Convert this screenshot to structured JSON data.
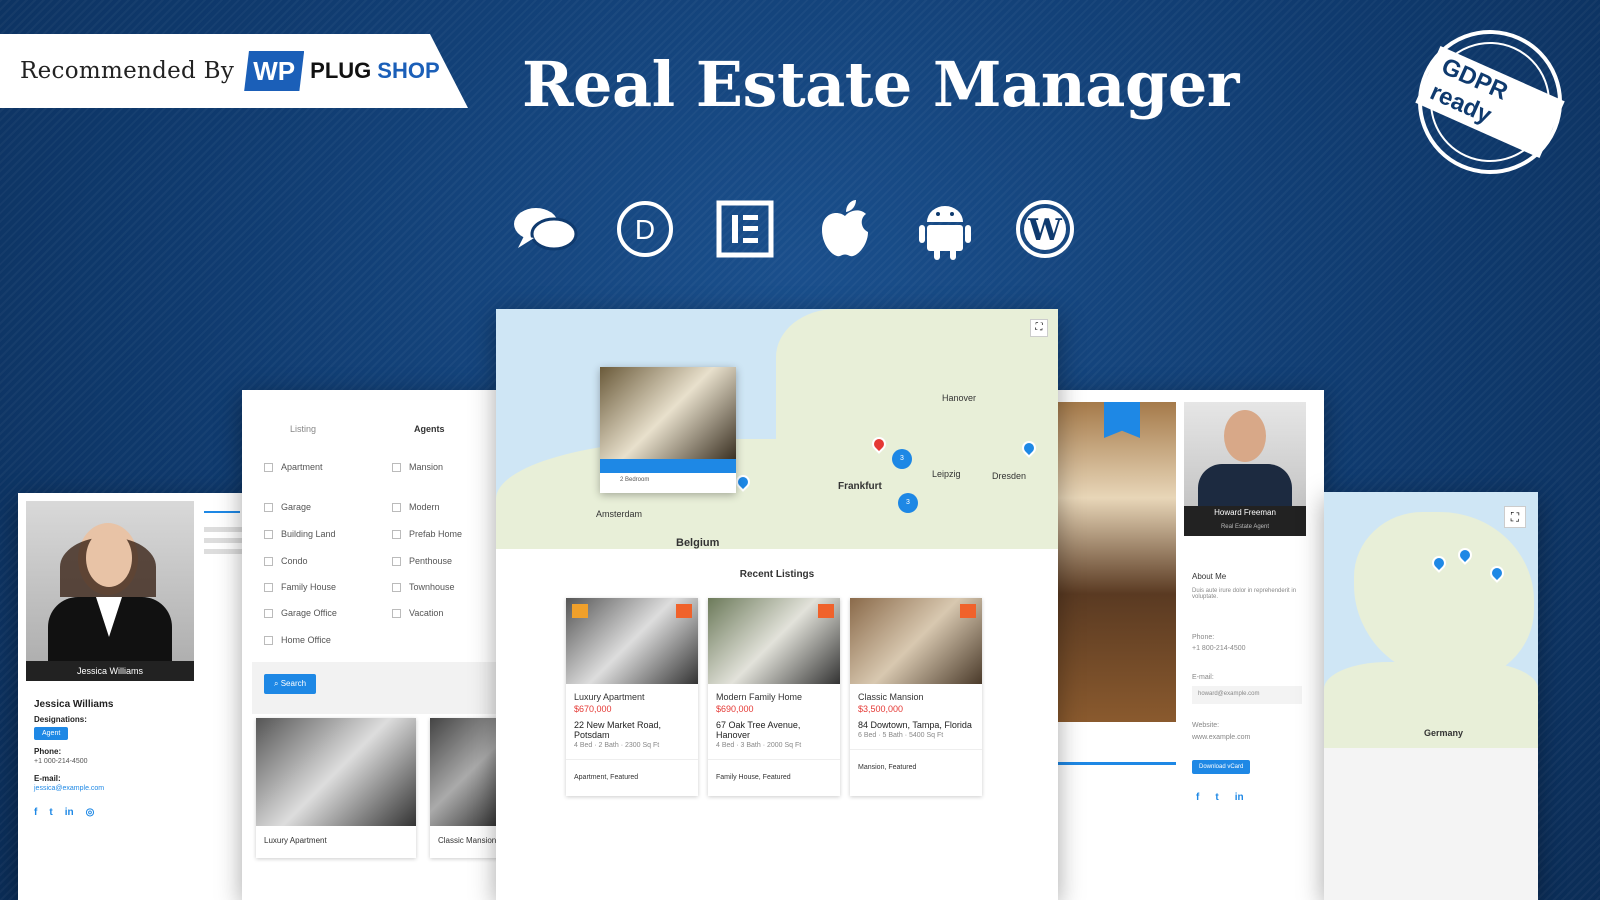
{
  "badge": {
    "recommended": "Recommended By",
    "wp": "WP",
    "plug": "PLUG",
    "shop": "SHOP"
  },
  "title": "Real Estate Manager",
  "stamp": "GDPR ready",
  "icons": [
    "chat-icon",
    "divi-icon",
    "elementor-icon",
    "apple-icon",
    "android-icon",
    "wordpress-icon"
  ],
  "colors": {
    "background": "#0f3a6e",
    "accent": "#1e88e5",
    "price": "#e53935",
    "tag": "#f0622b"
  },
  "agent_left": {
    "name": "Jessica Williams",
    "caption": "Jessica Williams",
    "designations_label": "Designations:",
    "designation": "Agent",
    "phone_label": "Phone:",
    "phone": "+1 000-214-4500",
    "email_label": "E-mail:",
    "email": "jessica@example.com"
  },
  "search": {
    "tab_listing": "Listing",
    "tab_agents": "Agents",
    "col1": [
      "Apartment",
      "Garage",
      "Building Land",
      "Condo",
      "Family House",
      "Garage Office",
      "Home Office"
    ],
    "col2": [
      "Mansion",
      "Modern",
      "Prefab Home",
      "Penthouse",
      "Townhouse",
      "Vacation"
    ],
    "button": "Search"
  },
  "search_results": {
    "r1_title": "Luxury Apartment",
    "r2_title": "Classic Mansion"
  },
  "map_main": {
    "cities": [
      "Hanover",
      "Frankfurt",
      "Belgium",
      "Leipzig",
      "Dresden",
      "Amsterdam"
    ],
    "popup_line": "2 Bedroom"
  },
  "recent": {
    "heading": "Recent Listings",
    "cards": [
      {
        "title": "Luxury Apartment",
        "price": "$670,000",
        "address": "22 New Market Road, Potsdam",
        "meta": "4 Bed · 2 Bath · 2300 Sq Ft",
        "footer": "Apartment, Featured"
      },
      {
        "title": "Modern Family Home",
        "price": "$690,000",
        "address": "67 Oak Tree Avenue, Hanover",
        "meta": "4 Bed · 3 Bath · 2000 Sq Ft",
        "footer": "Family House, Featured"
      },
      {
        "title": "Classic Mansion",
        "price": "$3,500,000",
        "address": "84 Dowtown, Tampa, Florida",
        "meta": "6 Bed · 5 Bath · 5400 Sq Ft",
        "footer": "Mansion, Featured"
      }
    ]
  },
  "agent_right": {
    "name": "Howard Freeman",
    "role": "Real Estate Agent",
    "about_label": "About Me",
    "about": "Duis aute irure dolor in reprehenderit in voluptate.",
    "phone_label": "Phone:",
    "phone": "+1 800-214-4500",
    "email_label": "E-mail:",
    "email": "howard@example.com",
    "website_label": "Website:",
    "website": "www.example.com",
    "vcard": "Download vCard"
  },
  "map_right": {
    "country": "Germany"
  }
}
